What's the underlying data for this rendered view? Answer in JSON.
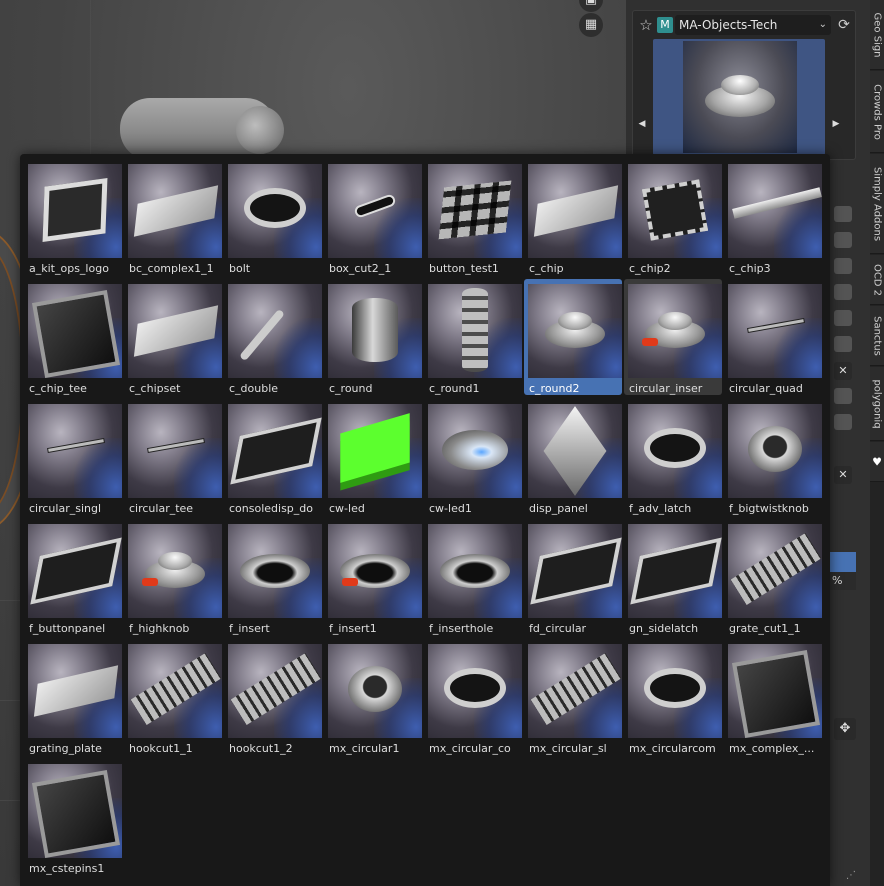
{
  "asset_panel": {
    "library_name": "MA-Objects-Tech",
    "material_badge": "M",
    "side_glyph": "",
    "percent_label": "%"
  },
  "n_panel_tabs": [
    "Geo Sign",
    "Crowds Pro",
    "Simply Addons",
    "OCD 2",
    "Sanctus",
    "polygoniq"
  ],
  "assets": [
    {
      "label": "a_kit_ops_logo",
      "shape": "s-square"
    },
    {
      "label": "bc_complex1_1",
      "shape": "s-plate"
    },
    {
      "label": "bolt",
      "shape": "s-ring"
    },
    {
      "label": "box_cut2_1",
      "shape": "s-slot"
    },
    {
      "label": "button_test1",
      "shape": "s-grid"
    },
    {
      "label": "c_chip",
      "shape": "s-plate"
    },
    {
      "label": "c_chip2",
      "shape": "s-chip"
    },
    {
      "label": "c_chip3",
      "shape": "s-bar"
    },
    {
      "label": "c_chip_tee",
      "shape": "s-dark"
    },
    {
      "label": "c_chipset",
      "shape": "s-plate"
    },
    {
      "label": "c_double",
      "shape": "s-stick"
    },
    {
      "label": "c_round",
      "shape": "s-cyl"
    },
    {
      "label": "c_round1",
      "shape": "s-tall"
    },
    {
      "label": "c_round2",
      "shape": "s-disc",
      "selected": true
    },
    {
      "label": "circular_inser",
      "shape": "s-disc",
      "hovered": true,
      "red": true
    },
    {
      "label": "circular_quad",
      "shape": "s-tee"
    },
    {
      "label": "circular_singl",
      "shape": "s-tee"
    },
    {
      "label": "circular_tee",
      "shape": "s-tee"
    },
    {
      "label": "consoledisp_do",
      "shape": "s-tray"
    },
    {
      "label": "cw-led",
      "shape": "s-green"
    },
    {
      "label": "cw-led1",
      "shape": "s-glass"
    },
    {
      "label": "disp_panel",
      "shape": "s-pyr"
    },
    {
      "label": "f_adv_latch",
      "shape": "s-ring"
    },
    {
      "label": "f_bigtwistknob",
      "shape": "s-knob"
    },
    {
      "label": "f_buttonpanel",
      "shape": "s-tray"
    },
    {
      "label": "f_highknob",
      "shape": "s-disc",
      "red": true
    },
    {
      "label": "f_insert",
      "shape": "s-hole"
    },
    {
      "label": "f_insert1",
      "shape": "s-hole",
      "red": true
    },
    {
      "label": "f_inserthole",
      "shape": "s-hole"
    },
    {
      "label": "fd_circular",
      "shape": "s-tray"
    },
    {
      "label": "gn_sidelatch",
      "shape": "s-tray"
    },
    {
      "label": "grate_cut1_1",
      "shape": "s-strip"
    },
    {
      "label": "grating_plate",
      "shape": "s-plate"
    },
    {
      "label": "hookcut1_1",
      "shape": "s-strip"
    },
    {
      "label": "hookcut1_2",
      "shape": "s-strip"
    },
    {
      "label": "mx_circular1",
      "shape": "s-knob"
    },
    {
      "label": "mx_circular_co",
      "shape": "s-ring"
    },
    {
      "label": "mx_circular_sl",
      "shape": "s-strip"
    },
    {
      "label": "mx_circularcom",
      "shape": "s-ring"
    },
    {
      "label": "mx_complex_...",
      "shape": "s-dark"
    },
    {
      "label": "mx_cstepins1",
      "shape": "s-dark"
    }
  ]
}
